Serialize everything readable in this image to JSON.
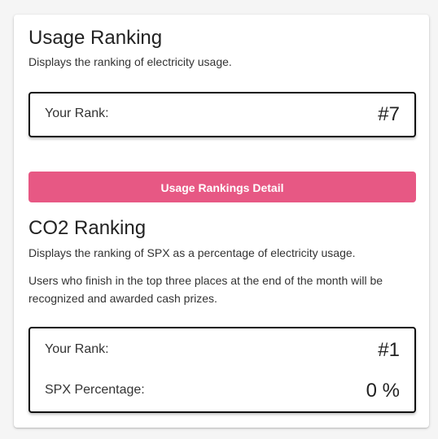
{
  "usage_ranking": {
    "title": "Usage Ranking",
    "description": "Displays the ranking of electricity usage.",
    "rank_label": "Your Rank:",
    "rank_value": "#7",
    "detail_button": "Usage Rankings Detail"
  },
  "co2_ranking": {
    "title": "CO2 Ranking",
    "description": "Displays the ranking of SPX as a percentage of electricity usage.",
    "note": "Users who finish in the top three places at the end of the month will be recognized and awarded cash prizes.",
    "rank_label": "Your Rank:",
    "rank_value": "#1",
    "spx_label": "SPX Percentage:",
    "spx_value": "0 %"
  },
  "colors": {
    "accent_button": "#e75884",
    "card_background": "#ffffff",
    "page_background": "#f5f5f5"
  }
}
